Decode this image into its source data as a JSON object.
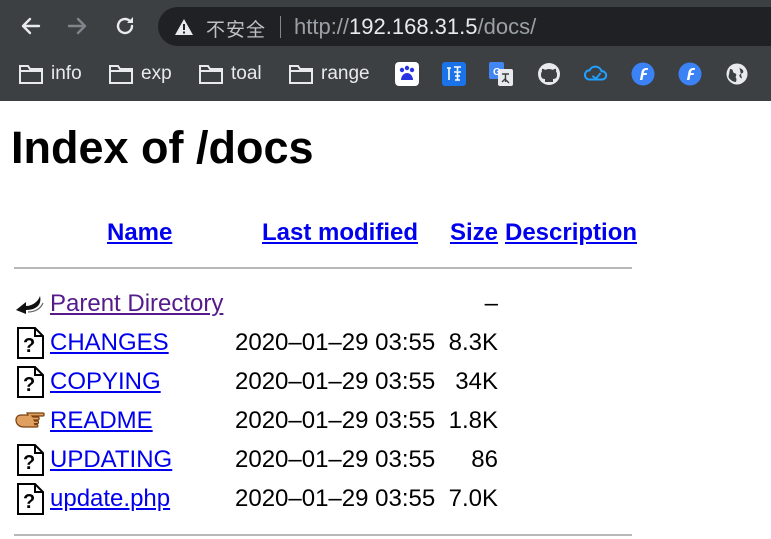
{
  "browser": {
    "security_label": "不安全",
    "url_scheme": "http://",
    "url_host": "192.168.31.5",
    "url_path": "/docs/",
    "bookmarks": [
      {
        "label": "info",
        "icon": "folder-icon"
      },
      {
        "label": "exp",
        "icon": "folder-icon"
      },
      {
        "label": "toal",
        "icon": "folder-icon"
      },
      {
        "label": "range",
        "icon": "folder-icon"
      }
    ],
    "bookmark_icons": [
      "baidu-icon",
      "translate-icon",
      "google-translate-icon",
      "github-icon",
      "cloud-icon",
      "fofa-icon",
      "fofa-icon",
      "globe-icon"
    ]
  },
  "page": {
    "title": "Index of /docs",
    "headers": {
      "name": "Name",
      "last_modified": "Last modified",
      "size": "Size",
      "description": "Description"
    },
    "rows": [
      {
        "name": "Parent Directory",
        "modified": "",
        "size": "–",
        "icon": "back-icon",
        "visited": true
      },
      {
        "name": "CHANGES",
        "modified": "2020–01–29 03:55",
        "size": "8.3K",
        "icon": "unknown-file-icon"
      },
      {
        "name": "COPYING",
        "modified": "2020–01–29 03:55",
        "size": "34K",
        "icon": "unknown-file-icon"
      },
      {
        "name": "README",
        "modified": "2020–01–29 03:55",
        "size": "1.8K",
        "icon": "hand-pointer-icon"
      },
      {
        "name": "UPDATING",
        "modified": "2020–01–29 03:55",
        "size": "86",
        "icon": "unknown-file-icon"
      },
      {
        "name": "update.php",
        "modified": "2020–01–29 03:55",
        "size": "7.0K",
        "icon": "unknown-file-icon"
      }
    ]
  },
  "colors": {
    "chrome_bg": "#3c4043",
    "omnibox_bg": "#202124",
    "link": "#0000ee",
    "visited_link": "#551a8b"
  }
}
